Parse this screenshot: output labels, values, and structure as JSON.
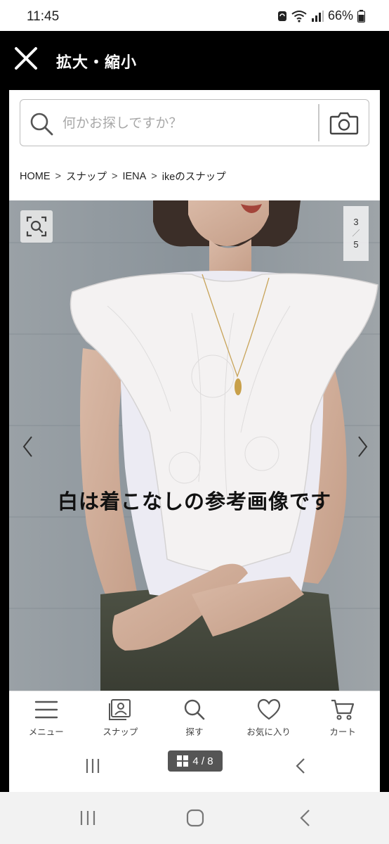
{
  "status_bar": {
    "time": "11:45",
    "battery": "66%"
  },
  "viewer": {
    "title": "拡大・縮小"
  },
  "search": {
    "placeholder": "何かお探しですか？"
  },
  "breadcrumb": [
    "HOME",
    "スナップ",
    "IENA",
    "ikeのスナップ"
  ],
  "breadcrumb_sep": ">",
  "photo": {
    "counter_current": "3",
    "counter_total": "5",
    "counter_sep": "／",
    "caption": "白は着こなしの参考画像です"
  },
  "site_nav": [
    {
      "label": "メニュー",
      "icon": "menu-icon"
    },
    {
      "label": "スナップ",
      "icon": "snap-icon"
    },
    {
      "label": "探す",
      "icon": "search-icon"
    },
    {
      "label": "お気に入り",
      "icon": "heart-icon"
    },
    {
      "label": "カート",
      "icon": "cart-icon"
    }
  ],
  "page_badge": "4 / 8",
  "colors": {
    "viewer_bg": "#000000",
    "nav_text": "#444444",
    "badge_bg": "#555555"
  }
}
